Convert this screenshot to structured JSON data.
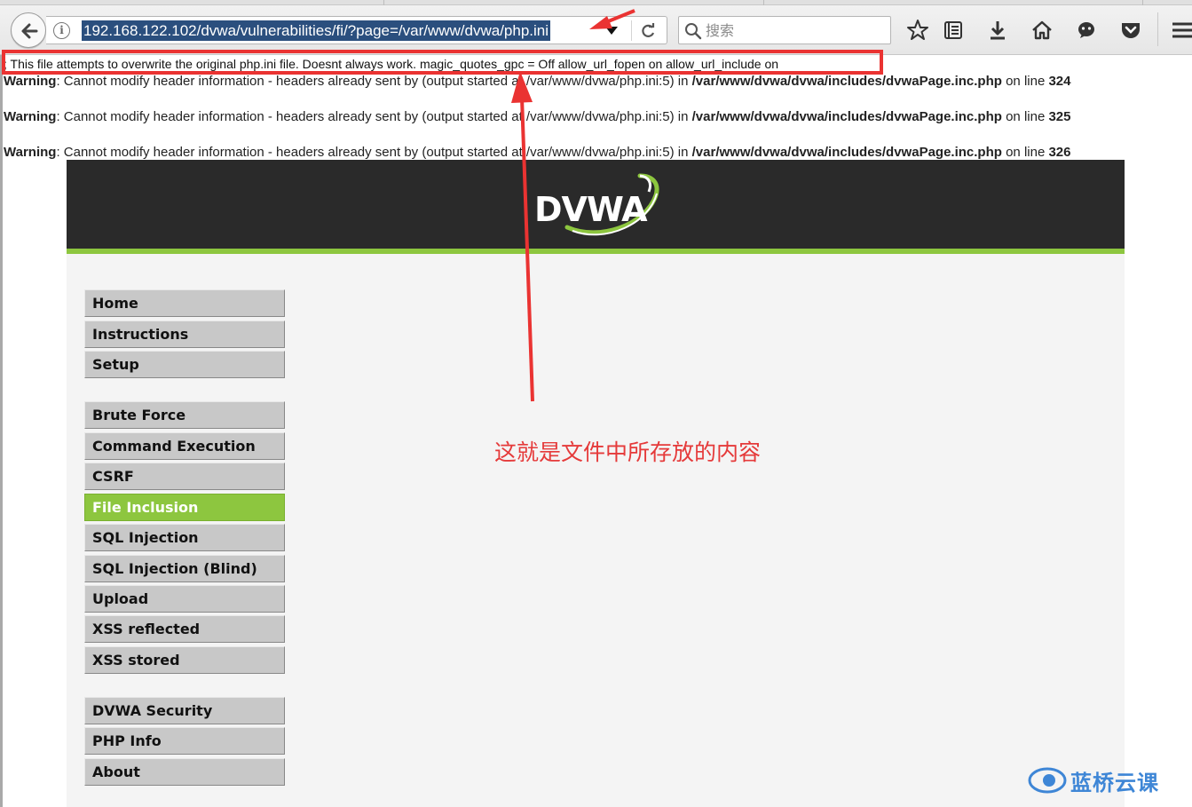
{
  "browser": {
    "url": "192.168.122.102/dvwa/vulnerabilities/fi/?page=/var/www/dvwa/php.ini",
    "search_placeholder": "搜索",
    "icons": [
      "back-icon",
      "info-icon",
      "url-dropdown-icon",
      "reload-icon",
      "search-icon",
      "bookmark-star-icon",
      "reading-list-icon",
      "download-icon",
      "home-icon",
      "chat-icon",
      "pocket-icon",
      "hamburger-menu-icon"
    ]
  },
  "page": {
    "file_content": "; This file attempts to overwrite the original php.ini file. Doesnt always work. magic_quotes_gpc = Off allow_url_fopen on allow_url_include on",
    "warnings": [
      {
        "label": "Warning",
        "message": ": Cannot modify header information - headers already sent by (output started at /var/www/dvwa/php.ini:5) in ",
        "file": "/var/www/dvwa/dvwa/includes/dvwaPage.inc.php",
        "on_line": " on line ",
        "line": "324"
      },
      {
        "label": "Warning",
        "message": ": Cannot modify header information - headers already sent by (output started at /var/www/dvwa/php.ini:5) in ",
        "file": "/var/www/dvwa/dvwa/includes/dvwaPage.inc.php",
        "on_line": " on line ",
        "line": "325"
      },
      {
        "label": "Warning",
        "message": ": Cannot modify header information - headers already sent by (output started at /var/www/dvwa/php.ini:5) in ",
        "file": "/var/www/dvwa/dvwa/includes/dvwaPage.inc.php",
        "on_line": " on line ",
        "line": "326"
      }
    ]
  },
  "dvwa": {
    "logo_text": "DVWA",
    "menu_groups": [
      [
        "Home",
        "Instructions",
        "Setup"
      ],
      [
        "Brute Force",
        "Command Execution",
        "CSRF",
        "File Inclusion",
        "SQL Injection",
        "SQL Injection (Blind)",
        "Upload",
        "XSS reflected",
        "XSS stored"
      ],
      [
        "DVWA Security",
        "PHP Info",
        "About"
      ]
    ],
    "active_item": "File Inclusion"
  },
  "annotation": {
    "text": "这就是文件中所存放的内容",
    "color": "#e53a3a"
  },
  "watermark": {
    "text": "蓝桥云课",
    "color": "#3e86d6"
  },
  "colors": {
    "dvwa_green": "#8dc63f",
    "dvwa_dark": "#2a2a2a",
    "url_highlight": "#2b4f7e"
  }
}
